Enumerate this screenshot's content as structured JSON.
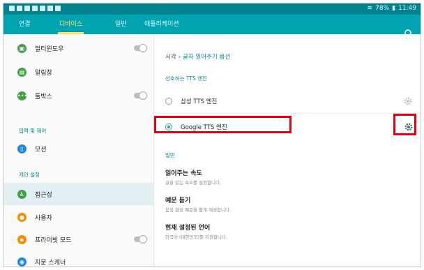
{
  "status_bar": {
    "battery": "78%",
    "time": "11:49"
  },
  "tabs": [
    "연결",
    "디바이스",
    "일반",
    "애플리케이션"
  ],
  "active_tab": "디바이스",
  "sidebar": {
    "items_top": [
      {
        "label": "멀티윈도우",
        "color": "#43a047",
        "toggle": true
      },
      {
        "label": "알림창",
        "color": "#43a047",
        "toggle": false
      },
      {
        "label": "툴박스",
        "color": "#43a047",
        "toggle": true
      }
    ],
    "section_input": "입력 및 제어",
    "motion": {
      "label": "모션",
      "color": "#1e88e5"
    },
    "section_personal": "개인 설정",
    "items_personal": [
      {
        "label": "접근성",
        "color": "#43a047",
        "selected": true
      },
      {
        "label": "사용자",
        "color": "#fb8c00"
      },
      {
        "label": "프라이빗 모드",
        "color": "#fb8c00",
        "toggle": true
      },
      {
        "label": "지문 스캐너",
        "color": "#1e88e5"
      }
    ]
  },
  "main": {
    "breadcrumb_parent": "시각",
    "breadcrumb_current": "글자 읽어주기 옵션",
    "preferred_engine_header": "선호하는 TTS 엔진",
    "engines": [
      {
        "label": "삼성 TTS 엔진",
        "selected": false
      },
      {
        "label": "Google TTS 엔진",
        "selected": true
      }
    ],
    "general_header": "일반",
    "general_items": [
      {
        "title": "읽어주는 속도",
        "subtitle": "글을 읽는 속도를 설정합니다."
      },
      {
        "title": "예문 듣기",
        "subtitle": "음성 합성 예문을 짧게 재생합니다."
      },
      {
        "title": "현재 설정된 언어",
        "subtitle": "한국어 (대한민국)를 지원합니다."
      }
    ]
  }
}
